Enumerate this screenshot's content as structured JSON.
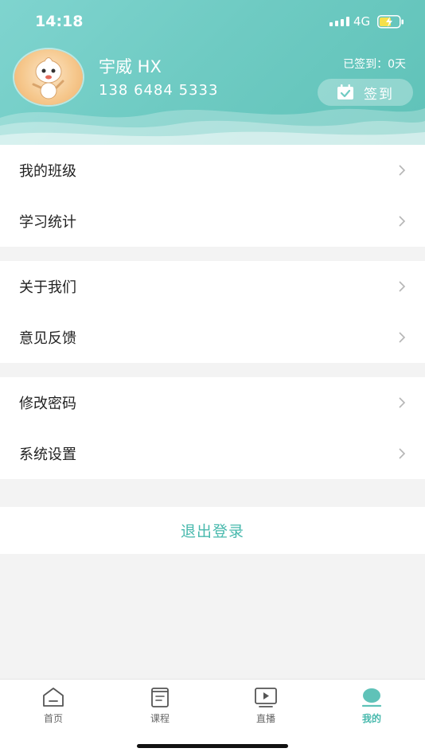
{
  "status_bar": {
    "time": "14:18",
    "network": "4G"
  },
  "profile": {
    "username": "宇威 HX",
    "phone": "138 6484 5333",
    "checkin_status": "已签到：0天",
    "checkin_button_label": "签到"
  },
  "menu_groups": [
    {
      "items": [
        {
          "label": "我的班级"
        },
        {
          "label": "学习统计"
        }
      ]
    },
    {
      "items": [
        {
          "label": "关于我们"
        },
        {
          "label": "意见反馈"
        }
      ]
    },
    {
      "items": [
        {
          "label": "修改密码"
        },
        {
          "label": "系统设置"
        }
      ]
    }
  ],
  "logout_label": "退出登录",
  "tabs": [
    {
      "label": "首页",
      "icon": "home-icon",
      "active": false
    },
    {
      "label": "课程",
      "icon": "book-icon",
      "active": false
    },
    {
      "label": "直播",
      "icon": "play-icon",
      "active": false
    },
    {
      "label": "我的",
      "icon": "profile-icon",
      "active": true
    }
  ],
  "colors": {
    "accent": "#48b9ad",
    "header": "#6fcbc3",
    "background": "#f3f3f3"
  }
}
